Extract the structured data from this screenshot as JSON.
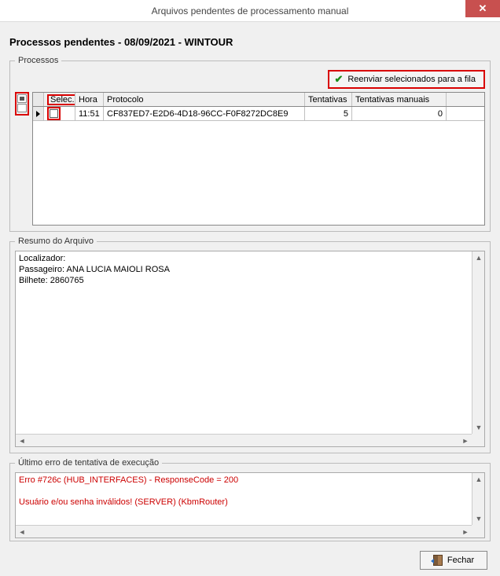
{
  "window": {
    "title": "Arquivos pendentes de processamento manual",
    "close_symbol": "✕"
  },
  "heading": "Processos pendentes - 08/09/2021 - WINTOUR",
  "processos": {
    "legend": "Processos",
    "resend_label": "Reenviar selecionados para a fila",
    "columns": {
      "selec": "Selec.",
      "hora": "Hora",
      "protocolo": "Protocolo",
      "tentativas": "Tentativas",
      "tentativas_manuais": "Tentativas manuais"
    },
    "rows": [
      {
        "hora": "11:51",
        "protocolo": "CF837ED7-E2D6-4D18-96CC-F0F8272DC8E9",
        "tentativas": "5",
        "tentativas_manuais": "0"
      }
    ]
  },
  "resumo": {
    "legend": "Resumo do Arquivo",
    "line1": "Localizador:",
    "line2": "Passageiro: ANA LUCIA MAIOLI ROSA",
    "line3": "Bilhete: 2860765"
  },
  "erro": {
    "legend": "Último erro de tentativa de execução",
    "line1": "Erro #726c (HUB_INTERFACES) - ResponseCode = 200",
    "line2": "Usuário e/ou senha inválidos! (SERVER) (KbmRouter)"
  },
  "footer": {
    "fechar_label": "Fechar"
  }
}
